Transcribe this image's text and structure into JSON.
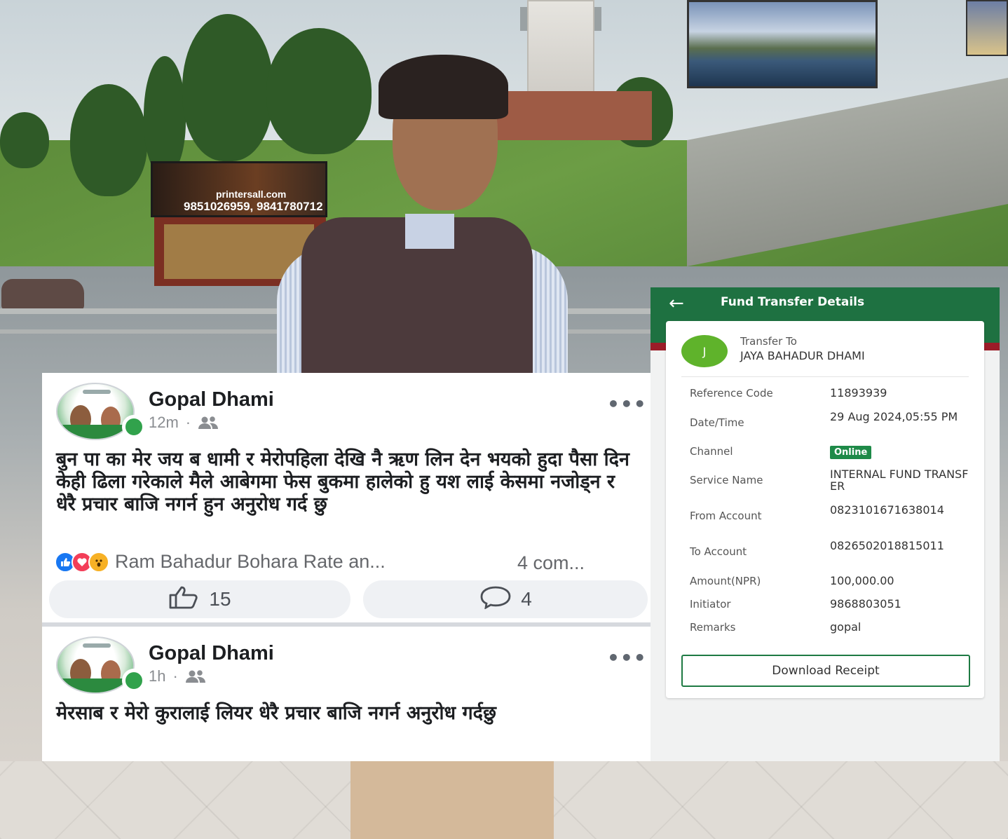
{
  "background": {
    "billboard_site": "printersall.com",
    "billboard_phone": "9851026959, 9841780712"
  },
  "facebook": {
    "posts": [
      {
        "author": "Gopal Dhami",
        "time": "12m",
        "separator": "·",
        "audience_icon": "friends-icon",
        "more": "•••",
        "text": "बुन पा का मेर जय ब धामी र मेरोपहिला देखि नै ऋण लिन देन भयको हुदा पैसा दिन केही ढिला गरेकाले मैले आबेगमा फेस बुकमा हालेको हु यश लाई केसमा नजोड्न र धेरै प्रचार बाजि नगर्न हुन अनुरोध गर्द छु",
        "reaction_icons": [
          "like-icon",
          "love-icon",
          "wow-icon"
        ],
        "reactions_text": "Ram Bahadur Bohara Rate an...",
        "comments_text": "4 com...",
        "like_count": "15",
        "comment_count": "4"
      },
      {
        "author": "Gopal Dhami",
        "time": "1h",
        "separator": "·",
        "audience_icon": "friends-icon",
        "more": "•••",
        "text": "मेरसाब र मेरो कुरालाई लियर धेरै प्रचार बाजि नगर्न अनुरोध गर्दछु"
      }
    ]
  },
  "fund_transfer": {
    "back_icon": "←",
    "title": "Fund Transfer Details",
    "avatar_letter": "J",
    "transfer_to_label": "Transfer To",
    "transfer_to_name": "JAYA BAHADUR DHAMI",
    "rows": [
      {
        "label": "Reference Code",
        "value": "11893939"
      },
      {
        "label": "Date/Time",
        "value": "29 Aug 2024,05:55 PM"
      },
      {
        "label": "Channel",
        "value": "Online"
      },
      {
        "label": "Service Name",
        "value": "INTERNAL FUND TRANSFER"
      },
      {
        "label": "From Account",
        "value": "0823101671638014"
      },
      {
        "label": "To Account",
        "value": "0826502018815011"
      },
      {
        "label": "Amount(NPR)",
        "value": "100,000.00"
      },
      {
        "label": "Initiator",
        "value": "9868803051"
      },
      {
        "label": "Remarks",
        "value": "gopal"
      }
    ],
    "download_label": "Download Receipt",
    "colors": {
      "header_green": "#1e7141",
      "accent_red": "#9b1c28",
      "online_green": "#1e8a48"
    }
  }
}
